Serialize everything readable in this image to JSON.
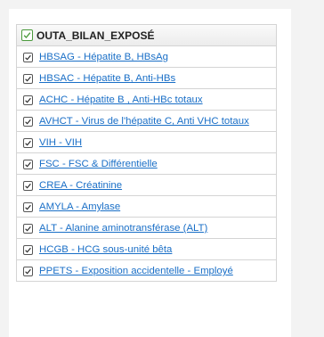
{
  "panel": {
    "title": "OUTA_BILAN_EXPOSÉ",
    "items": [
      {
        "label": "HBSAG - Hépatite B, HBsAg"
      },
      {
        "label": "HBSAC - Hépatite B, Anti-HBs"
      },
      {
        "label": "ACHC - Hépatite B , Anti-HBc totaux"
      },
      {
        "label": "AVHCT - Virus de l'hépatite C, Anti VHC totaux"
      },
      {
        "label": "VIH - VIH"
      },
      {
        "label": "FSC - FSC & Différentielle"
      },
      {
        "label": "CREA - Créatinine"
      },
      {
        "label": "AMYLA - Amylase"
      },
      {
        "label": "ALT - Alanine aminotransférase (ALT)"
      },
      {
        "label": "HCGB - HCG sous-unité bêta"
      },
      {
        "label": "PPETS - Exposition accidentelle - Employé"
      }
    ]
  }
}
